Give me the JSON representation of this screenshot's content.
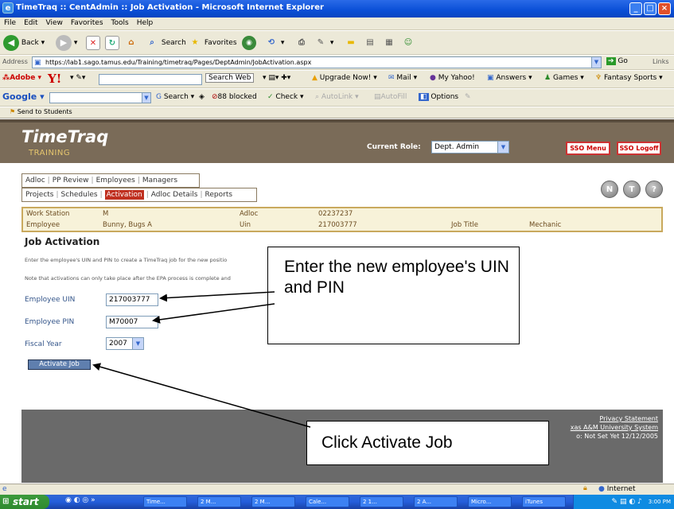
{
  "window": {
    "title": "TimeTraq :: CentAdmin :: Job Activation - Microsoft Internet Explorer",
    "controls": [
      "_",
      "□",
      "×"
    ]
  },
  "menu": [
    "File",
    "Edit",
    "View",
    "Favorites",
    "Tools",
    "Help"
  ],
  "toolbar": {
    "back": "Back",
    "search": "Search",
    "favorites": "Favorites"
  },
  "address": {
    "label": "Address",
    "url": "https://lab1.sago.tamus.edu/Training/timetraq/Pages/DeptAdmin/JobActivation.aspx",
    "go": "Go",
    "links": "Links"
  },
  "yahoo": {
    "adobe": "Adobe",
    "search_web": "Search Web",
    "upgrade": "Upgrade Now!",
    "mail": "Mail",
    "my_yahoo": "My Yahoo!",
    "answers": "Answers",
    "games": "Games",
    "fantasy": "Fantasy Sports"
  },
  "google": {
    "label": "Google",
    "search": "Search",
    "blocked": "88 blocked",
    "check": "Check",
    "autolink": "AutoLink",
    "autofill": "AutoFill",
    "options": "Options"
  },
  "links": {
    "send": "Send to Students"
  },
  "app": {
    "logo": "TimeTraq",
    "env": "TRAINING",
    "role_label": "Current Role:",
    "role_value": "Dept. Admin",
    "sso_menu": "SSO Menu",
    "sso_logoff": "SSO Logoff",
    "nav1": [
      "Adloc",
      "PP Review",
      "Employees",
      "Managers"
    ],
    "nav2": [
      "Projects",
      "Schedules",
      "Activation",
      "Adloc Details",
      "Reports"
    ],
    "icons": [
      "N",
      "T",
      "?"
    ]
  },
  "info": {
    "workstation_label": "Work Station",
    "workstation_value": "M",
    "adloc_label": "Adloc",
    "adloc_value": "02237237",
    "employee_label": "Employee",
    "employee_value": "Bunny, Bugs A",
    "uin_label": "Uin",
    "uin_value": "217003777",
    "jobtitle_label": "Job Title",
    "jobtitle_value": "Mechanic"
  },
  "form": {
    "heading": "Job Activation",
    "note1": "Enter the employee's UIN and PIN to create a TimeTraq job for the new positio",
    "note2": "Note that activations can only take place after the EPA process is complete and",
    "uin_label": "Employee UIN",
    "uin_value": "217003777",
    "pin_label": "Employee PIN",
    "pin_value": "M70007",
    "fy_label": "Fiscal Year",
    "fy_value": "2007",
    "activate": "Activate Job"
  },
  "footer": {
    "privacy": "Privacy Statement",
    "system": "xas A&M University System",
    "notset": "o:  Not Set Yet 12/12/2005"
  },
  "callouts": {
    "enter": "Enter the new employee's UIN and PIN",
    "click": "Click Activate Job"
  },
  "status": {
    "zone": "Internet"
  },
  "taskbar": {
    "start": "start",
    "tasks": [
      "Time...",
      "2 M...",
      "2 M...",
      "Cale...",
      "2 1...",
      "2 A...",
      "Micro...",
      "iTunes"
    ],
    "clock": "3:00 PM"
  },
  "colors": {
    "banner": "#7a6b58",
    "accent_red": "#c03020",
    "info_bg": "#f7f2d9",
    "button_blue": "#5f7fae"
  }
}
